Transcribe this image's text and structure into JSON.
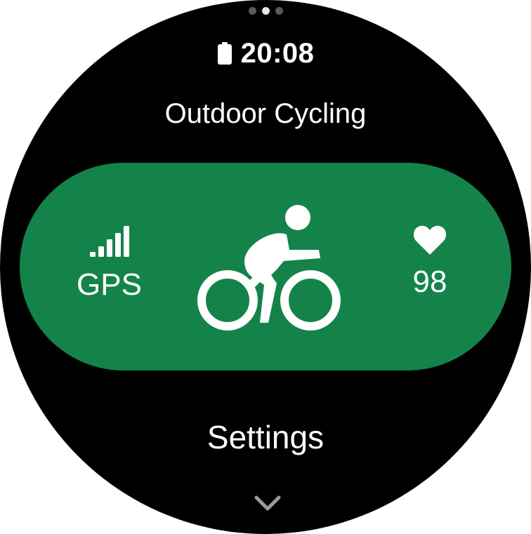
{
  "status_bar": {
    "time": "20:08",
    "battery_icon": "battery-icon",
    "page_indicator": {
      "count": 3,
      "active_index": 1
    }
  },
  "workout": {
    "title": "Outdoor Cycling",
    "activity_icon": "cyclist-icon"
  },
  "start_card": {
    "gps": {
      "icon": "signal-bars-icon",
      "label": "GPS"
    },
    "heart_rate": {
      "icon": "heart-icon",
      "value": "98"
    }
  },
  "menu": {
    "settings_label": "Settings",
    "more_icon": "chevron-down-icon"
  },
  "colors": {
    "background": "#000000",
    "accent_green": "#14834a",
    "text": "#ffffff"
  }
}
